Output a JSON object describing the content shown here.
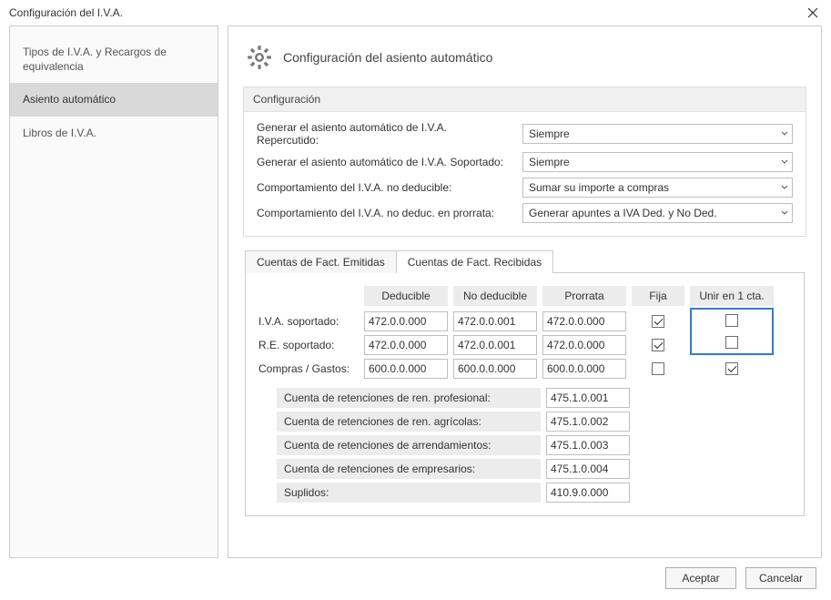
{
  "titlebar": {
    "title": "Configuración del I.V.A."
  },
  "sidebar": {
    "items": [
      {
        "label": "Tipos de I.V.A. y Recargos de equivalencia",
        "selected": false
      },
      {
        "label": "Asiento automático",
        "selected": true
      },
      {
        "label": "Libros de I.V.A.",
        "selected": false
      }
    ]
  },
  "section": {
    "title": "Configuración del asiento automático"
  },
  "config_group": {
    "header": "Configuración",
    "rows": [
      {
        "label": "Generar el asiento automático de I.V.A. Repercutido:",
        "value": "Siempre"
      },
      {
        "label": "Generar el asiento automático de I.V.A. Soportado:",
        "value": "Siempre"
      },
      {
        "label": "Comportamiento del I.V.A. no deducible:",
        "value": "Sumar su importe a compras"
      },
      {
        "label": "Comportamiento del I.V.A. no deduc. en prorrata:",
        "value": "Generar apuntes a IVA Ded. y No Ded."
      }
    ]
  },
  "tabs": {
    "items": [
      {
        "label": "Cuentas de Fact. Emitidas",
        "active": false
      },
      {
        "label": "Cuentas de Fact. Recibidas",
        "active": true
      }
    ]
  },
  "cuentas_recibidas": {
    "headers": {
      "c1": "Deducible",
      "c2": "No deducible",
      "c3": "Prorrata",
      "c4": "Fija",
      "c5": "Unir en 1 cta."
    },
    "rows": [
      {
        "label": "I.V.A. soportado:",
        "ded": "472.0.0.000",
        "noded": "472.0.0.001",
        "pror": "472.0.0.000",
        "fija": true,
        "unir": false
      },
      {
        "label": "R.E. soportado:",
        "ded": "472.0.0.000",
        "noded": "472.0.0.001",
        "pror": "472.0.0.000",
        "fija": true,
        "unir": false
      },
      {
        "label": "Compras / Gastos:",
        "ded": "600.0.0.000",
        "noded": "600.0.0.000",
        "pror": "600.0.0.000",
        "fija": false,
        "unir": true
      }
    ],
    "retenciones": [
      {
        "label": "Cuenta de retenciones de ren. profesional:",
        "value": "475.1.0.001"
      },
      {
        "label": "Cuenta de retenciones de ren. agrícolas:",
        "value": "475.1.0.002"
      },
      {
        "label": "Cuenta de retenciones de arrendamientos:",
        "value": "475.1.0.003"
      },
      {
        "label": "Cuenta de retenciones de empresarios:",
        "value": "475.1.0.004"
      },
      {
        "label": "Suplidos:",
        "value": "410.9.0.000"
      }
    ]
  },
  "footer": {
    "ok": "Aceptar",
    "cancel": "Cancelar"
  }
}
